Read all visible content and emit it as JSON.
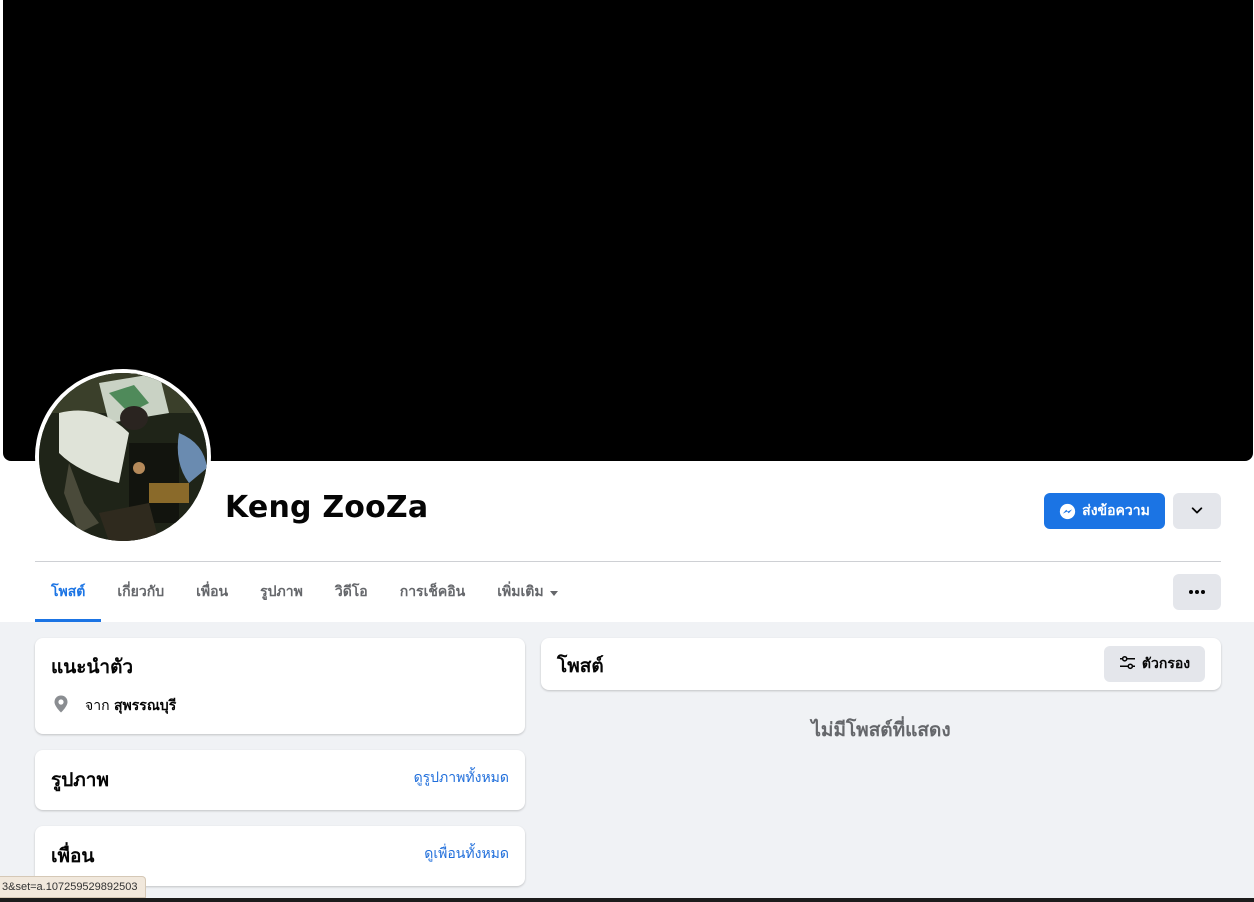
{
  "profile": {
    "name": "Keng ZooZa"
  },
  "actions": {
    "message_label": "ส่งข้อความ"
  },
  "tabs": [
    {
      "label": "โพสต์",
      "active": true
    },
    {
      "label": "เกี่ยวกับ",
      "active": false
    },
    {
      "label": "เพื่อน",
      "active": false
    },
    {
      "label": "รูปภาพ",
      "active": false
    },
    {
      "label": "วิดีโอ",
      "active": false
    },
    {
      "label": "การเช็คอิน",
      "active": false
    },
    {
      "label": "เพิ่มเติม",
      "active": false
    }
  ],
  "intro": {
    "title": "แนะนำตัว",
    "from_prefix": "จาก",
    "from_place": "สุพรรณบุรี"
  },
  "photos": {
    "title": "รูปภาพ",
    "see_all": "ดูรูปภาพทั้งหมด"
  },
  "friends": {
    "title": "เพื่อน",
    "see_all": "ดูเพื่อนทั้งหมด"
  },
  "posts": {
    "title": "โพสต์",
    "filter_label": "ตัวกรอง",
    "empty_message": "ไม่มีโพสต์ที่แสดง"
  },
  "status_bar": {
    "url": "3&set=a.107259529892503"
  },
  "colors": {
    "accent": "#1b74e4",
    "link": "#216fdb",
    "page_bg": "#f0f2f5",
    "cover": "#000000"
  },
  "icons": [
    "messenger-icon",
    "chevron-down-icon",
    "more-dots-icon",
    "location-pin-icon",
    "filter-sliders-icon",
    "caret-down-icon"
  ]
}
